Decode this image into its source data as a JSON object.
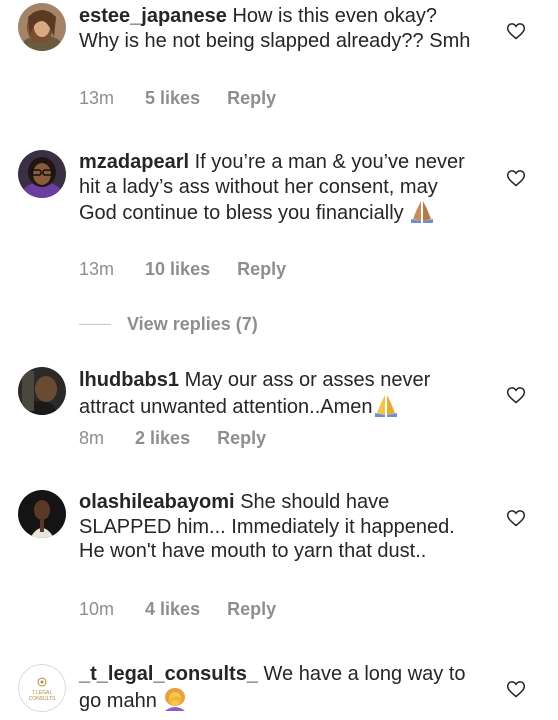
{
  "comments": [
    {
      "username": "estee_japanese",
      "text": "How is this even okay? Why is he not being slapped already?? Smh",
      "time": "13m",
      "likes": "5 likes",
      "reply": "Reply",
      "avatar": "avatar-woman-brown-hair"
    },
    {
      "username": "mzadapearl",
      "text": "If you’re a man & you’ve never hit a lady’s ass without her consent, may God continue to bless you financially",
      "emoji": "praying-hands-emoji",
      "time": "13m",
      "likes": "10 likes",
      "reply": "Reply",
      "avatar": "avatar-woman-glasses"
    },
    {
      "username": "lhudbabs1",
      "text": "May our ass or asses never attract unwanted attention..Amen",
      "emoji": "praying-hands-emoji",
      "time": "8m",
      "likes": "2 likes",
      "reply": "Reply",
      "avatar": "avatar-man-dark"
    },
    {
      "username": "olashileabayomi",
      "text": "She should have SLAPPED him... Immediately it happened. He won't have mouth to yarn that dust..",
      "time": "10m",
      "likes": "4 likes",
      "reply": "Reply",
      "avatar": "avatar-woman-dark-bg"
    },
    {
      "username": "_t_legal_consults_",
      "text": "We have a long way to go mahn",
      "emoji": "woman-facepalming-emoji",
      "avatar": "avatar-logo-legal-consults",
      "avatar_logo_text": "T LEGAL CONSULTS"
    }
  ],
  "view_replies": "View replies (7)",
  "colors": {
    "text": "#262626",
    "secondary": "#8e8e8e",
    "divider": "#c7c7c7"
  }
}
